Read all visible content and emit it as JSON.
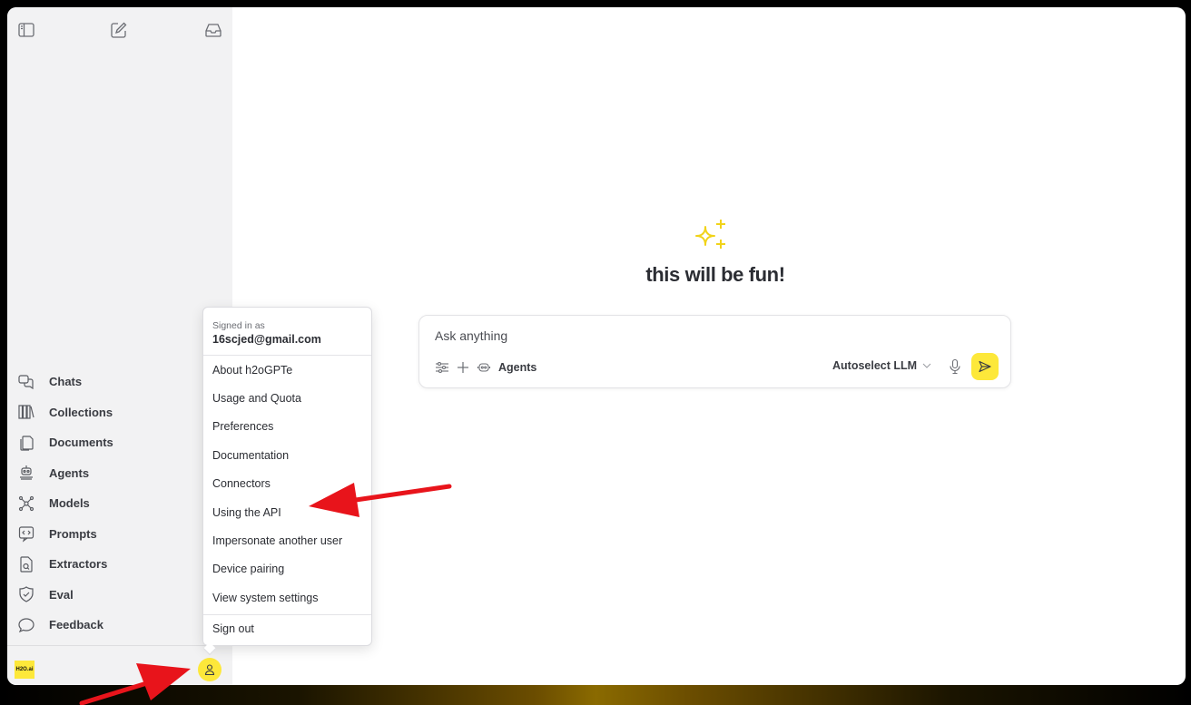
{
  "main": {
    "hero_title": "this will be fun!",
    "composer": {
      "placeholder": "Ask anything",
      "agents_label": "Agents",
      "llm_label": "Autoselect LLM"
    }
  },
  "sidebar": {
    "items": [
      {
        "label": "Chats",
        "icon": "chats-icon"
      },
      {
        "label": "Collections",
        "icon": "collections-icon"
      },
      {
        "label": "Documents",
        "icon": "documents-icon"
      },
      {
        "label": "Agents",
        "icon": "agents-icon"
      },
      {
        "label": "Models",
        "icon": "models-icon"
      },
      {
        "label": "Prompts",
        "icon": "prompts-icon"
      },
      {
        "label": "Extractors",
        "icon": "extractors-icon"
      },
      {
        "label": "Eval",
        "icon": "eval-icon"
      },
      {
        "label": "Feedback",
        "icon": "feedback-icon"
      }
    ],
    "logo_text": "H2O.ai"
  },
  "user_menu": {
    "signed_in_label": "Signed in as",
    "email": "16scjed@gmail.com",
    "items": [
      "About h2oGPTe",
      "Usage and Quota",
      "Preferences",
      "Documentation",
      "Connectors",
      "Using the API",
      "Impersonate another user",
      "Device pairing",
      "View system settings"
    ],
    "sign_out": "Sign out"
  },
  "colors": {
    "accent": "#fde83a",
    "annotation_arrow": "#e8141b",
    "sidebar_bg": "#f2f2f3"
  }
}
